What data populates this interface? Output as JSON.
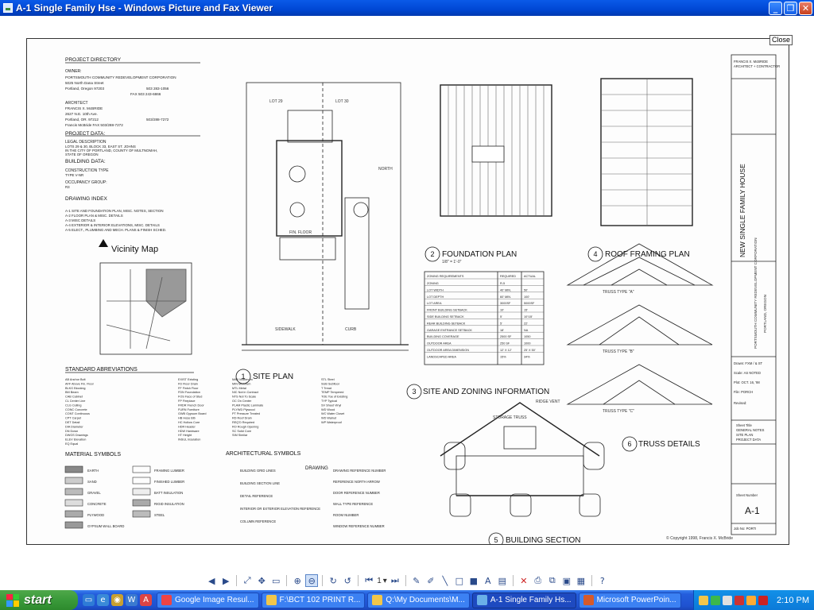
{
  "window": {
    "title": "A-1 Single Family Hse - Windows Picture and Fax Viewer",
    "close_label": "Close"
  },
  "drawing": {
    "project_directory": {
      "heading": "PROJECT DIRECTORY",
      "owner_label": "OWNER:",
      "owner": [
        "PORTSMOUTH COMMUNITY REDEVELOPMENT CORPORATION",
        "5025 North Dana Street",
        "Portland, Oregon 97203",
        "503 283-1056",
        "FAX 503 243-6866"
      ],
      "architect_label": "ARCHITECT",
      "architect": [
        "FRANCIS X. McBRIDE",
        "2627 N.E. 10th Ave.",
        "Portland, OR. 97212",
        "503/288-7272",
        "Francis McBride FAX 503/288-7272"
      ]
    },
    "project_data": {
      "heading": "PROJECT DATA:",
      "legal_heading": "LEGAL DESCRIPTION",
      "legal": [
        "LOTS 29 & 30, BLOCK 33, EAST ST. JOHNS",
        "IN THE CITY OF PORTLAND, COUNTY OF MULTNOMAH,",
        "STATE OF OREGON"
      ],
      "building_heading": "BUILDING DATA:",
      "construction_label": "CONSTRUCTION TYPE",
      "construction": "TYPE V-NR",
      "occupancy_label": "OCCUPANCY GROUP:",
      "occupancy": "R3"
    },
    "drawing_index": {
      "heading": "DRAWING INDEX",
      "items": [
        "A-1  SITE AND FOUNDATION PLAN, MISC. NOTES, SECTION",
        "A-2  FLOOR PLAN & MISC. DETAILS",
        "A-3  MISC DETAILS",
        "A-4  EXTERIOR & INTERIOR ELEVATIONS, MISC. DETAILS",
        "A-5  ELECT., PLUMBING AND MECH. PLANS & FINISH SCHED."
      ]
    },
    "vicinity_map": "Vicinity Map",
    "site_plan": {
      "number": "1",
      "title": "SITE PLAN",
      "lot_a": "LOT 29",
      "lot_b": "LOT 30",
      "floor": "FIN. FLOOR",
      "north": "NORTH",
      "sidewalk": "SIDEWALK",
      "curb": "CURB"
    },
    "foundation_plan": {
      "number": "2",
      "title": "FOUNDATION PLAN",
      "scale": "1/8\" = 1'-0\""
    },
    "roof_framing": {
      "number": "4",
      "title": "ROOF FRAMING PLAN"
    },
    "site_zoning": {
      "number": "3",
      "title": "SITE AND ZONING INFORMATION",
      "headers": [
        "ZONING REQUIREMENTS",
        "REQUIRED",
        "ACTUAL"
      ],
      "rows": [
        [
          "ZONING",
          "R-5",
          ""
        ],
        [
          "LOT WIDTH",
          "40' MIN.",
          "50'"
        ],
        [
          "LOT DEPTH",
          "60' MIN.",
          "100'"
        ],
        [
          "LOT AREA",
          "3000SF",
          "5000SF"
        ],
        [
          "FRONT BUILDING SETBACK",
          "10'",
          "15'"
        ],
        [
          "SIDE BUILDING SETBACK",
          "5'",
          "10'/15'"
        ],
        [
          "REAR BUILDING SETBACK",
          "5'",
          "22'"
        ],
        [
          "GARAGE ENTRANCE SETBACK",
          "18'",
          "NA"
        ],
        [
          "BUILDING COVERAGE",
          "2500 SF",
          "1050"
        ],
        [
          "OUTDOOR AREA",
          "250 SF",
          "1000"
        ],
        [
          "OUTDOOR AREA DIMENSION",
          "12' X 12'",
          "25' X 50'"
        ],
        [
          "LANDSCAPED AREA",
          "15%",
          "34%"
        ]
      ]
    },
    "truss_labels": [
      "TRUSS TYPE \"A\"",
      "TRUSS TYPE \"B\"",
      "TRUSS TYPE \"C\""
    ],
    "truss_details": {
      "number": "6",
      "title": "TRUSS DETAILS"
    },
    "building_section": {
      "number": "5",
      "title": "BUILDING SECTION",
      "ridge": "RIDGE VENT",
      "storage": "STORAGE TRUSS"
    },
    "abbreviations": {
      "heading": "STANDARD ABREVIATIONS",
      "cols": [
        [
          "AB Anchor Bolt",
          "AFF Above Fin. Floor",
          "BLKG Blocking",
          "BM Beam",
          "CAB Cabinet",
          "CL Center Line",
          "CLG Ceiling",
          "CONC Concrete",
          "CONT Continuous",
          "CPT Carpet",
          "DET Detail",
          "DIA Diameter",
          "DN Down",
          "DWGS Drawings",
          "ELEV Elevation",
          "EQ Equal"
        ],
        [
          "EXIST Existing",
          "FD Floor Drain",
          "FF Finish Floor",
          "FDN Foundation",
          "FOS Face of Stud",
          "FP Fireplace",
          "FRDR French Door",
          "FURN Furniture",
          "GWB Gypsum Board",
          "HB Hose Bib",
          "HC Hollow Core",
          "HDR Header",
          "HDW Hardware",
          "HT Height",
          "INSUL Insulation"
        ],
        [
          "MAX Maximum",
          "MIN Minimum",
          "MTL Metal",
          "NIC Not in Contract",
          "NTS Not To Scale",
          "OC On Center",
          "PLAM Plastic Laminate",
          "PLYWD Plywood",
          "PT Pressure Treated",
          "RD Roof Drain",
          "REQ'D Required",
          "RO Rough Opening",
          "SC Solid Core",
          "SIM Similar"
        ],
        [
          "STL Steel",
          "SUB Subfloor",
          "T Tread",
          "TEMP Tempered",
          "TOE Toe of Existing",
          "TYP Typical",
          "SV Sheet Vinyl",
          "WD Wood",
          "WC Water Closet",
          "WD Walnut",
          "WP Waterproof"
        ]
      ]
    },
    "material_symbols": {
      "heading": "MATERIAL SYMBOLS",
      "items": [
        "EARTH",
        "SAND",
        "GRAVEL",
        "CONCRETE",
        "PLYWOOD",
        "GYPSUM WALL BOARD",
        "FRAMING LUMBER",
        "FINISHED LUMBER",
        "BATT INSULATION",
        "RIGID INSULATION",
        "STEEL"
      ]
    },
    "architectural_symbols": {
      "heading": "ARCHITECTURAL SYMBOLS",
      "items": [
        "BUILDING GRID LINES",
        "BUILDING SECTION LINE",
        "DETAIL REFERENCE",
        "INTERIOR OR EXTERIOR ELEVATION REFERENCE",
        "COLUMN REFERENCE",
        "DRAWING REFERENCE NUMBER",
        "REFERENCE NORTH ARROW",
        "DOOR REFERENCE NUMBER",
        "WALL TYPE REFERENCE",
        "ROOM NUMBER",
        "WINDOW REFERENCE NUMBER"
      ],
      "drawing_label": "DRAWING"
    },
    "title_block": {
      "firm": [
        "FRANCIS X. McBRIDE",
        "ARCHITECT + CONTRACTOR"
      ],
      "project": "NEW SINGLE FAMILY HOUSE",
      "client": "PORTSMOUTH COMMUNITY REDEVELOPMENT CORPORATION",
      "city": "PORTLAND, OREGON",
      "drawn": "Drawn: FXM / & ST",
      "scale": "Scale: AS NOTED",
      "plot": "Plot: OCT. 16, '98",
      "file": "File: PORCH",
      "revised": "Revised:",
      "sheet_title": [
        "Sheet Title",
        "GENERAL NOTES",
        "SITE PLAN",
        "PROJECT DATA"
      ],
      "sheet_number_label": "Sheet Number",
      "sheet_number": "A-1",
      "job_no": "Job No: PORTI"
    },
    "copyright": "© Copyright 1998, Francis X. McBride"
  },
  "toolbar": {
    "page": "1"
  },
  "taskbar": {
    "start": "start",
    "tasks": [
      "Google Image Resul...",
      "F:\\BCT 102 PRINT R...",
      "Q:\\My Documents\\M...",
      "A-1 Single Family Hs...",
      "Microsoft PowerPoin..."
    ],
    "clock": "2:10 PM"
  },
  "colors": {
    "titlebar": "#0a5ae8",
    "taskbar": "#245ddc",
    "start": "#3a9a3a",
    "tray": "#0c7ad8"
  }
}
